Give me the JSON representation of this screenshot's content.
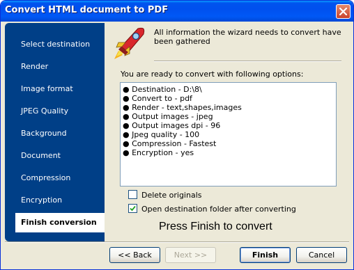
{
  "window": {
    "title": "Convert HTML document to PDF"
  },
  "sidebar": {
    "items": [
      {
        "label": "Select destination"
      },
      {
        "label": "Render"
      },
      {
        "label": "Image format"
      },
      {
        "label": "JPEG Quality"
      },
      {
        "label": "Background"
      },
      {
        "label": "Document"
      },
      {
        "label": "Compression"
      },
      {
        "label": "Encryption"
      },
      {
        "label": "Finish conversion",
        "active": true
      }
    ]
  },
  "main": {
    "info": "All information the wizard needs to convert have been gathered",
    "ready_label": "You are ready to convert with following options:",
    "options": [
      "● Destination - D:\\8\\",
      "● Convert to - pdf",
      "● Render - text,shapes,images",
      "● Output images - jpeg",
      "● Output images dpi - 96",
      "● Jpeg quality - 100",
      "● Compression - Fastest",
      "● Encryption - yes"
    ],
    "delete_originals": {
      "label": "Delete originals",
      "checked": false
    },
    "open_folder": {
      "label": "Open destination folder after converting",
      "checked": true
    },
    "press_finish": "Press Finish to convert"
  },
  "buttons": {
    "back": "<< Back",
    "next": "Next >>",
    "finish": "Finish",
    "cancel": "Cancel"
  }
}
